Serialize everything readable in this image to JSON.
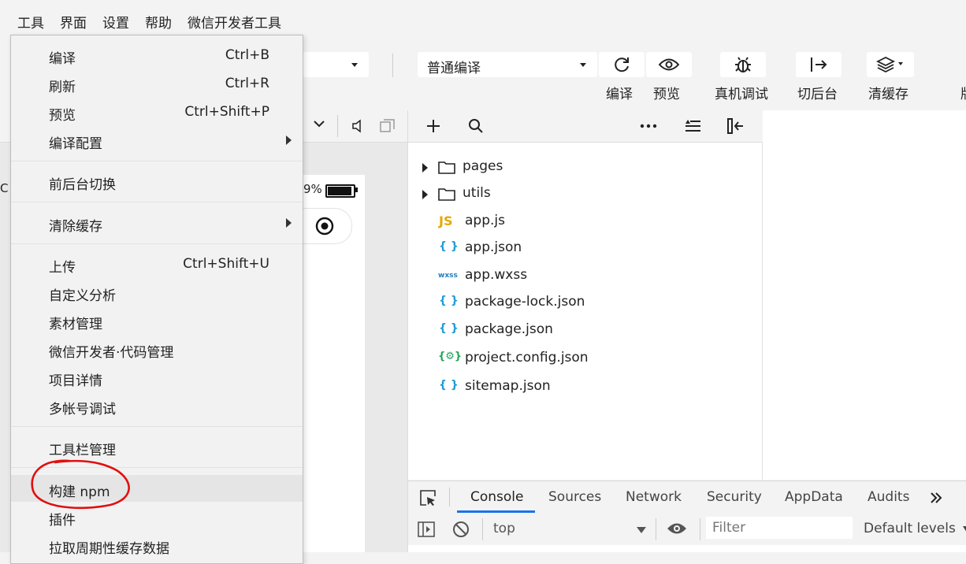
{
  "menubar": {
    "items": [
      "工具",
      "界面",
      "设置",
      "帮助",
      "微信开发者工具"
    ]
  },
  "toolbar": {
    "mode_select": "普通编译",
    "buttons": [
      {
        "label": "编译",
        "icon": "refresh-icon"
      },
      {
        "label": "预览",
        "icon": "eye-icon"
      },
      {
        "label": "真机调试",
        "icon": "bug-icon"
      },
      {
        "label": "切后台",
        "icon": "switch-background-icon"
      },
      {
        "label": "清缓存",
        "icon": "layers-icon"
      }
    ]
  },
  "simulator": {
    "battery_text": "9%"
  },
  "explorer": {
    "folders": [
      "pages",
      "utils"
    ],
    "files": [
      {
        "name": "app.js",
        "icon_text": "JS",
        "color": "#e6a700"
      },
      {
        "name": "app.json",
        "icon_text": "{ }",
        "color": "#1e9bd7"
      },
      {
        "name": "app.wxss",
        "icon_text": "wxss",
        "color": "#1e7fbf"
      },
      {
        "name": "package-lock.json",
        "icon_text": "{ }",
        "color": "#1e9bd7"
      },
      {
        "name": "package.json",
        "icon_text": "{ }",
        "color": "#1e9bd7"
      },
      {
        "name": "project.config.json",
        "icon_text": "{⚙}",
        "color": "#22a35a"
      },
      {
        "name": "sitemap.json",
        "icon_text": "{ }",
        "color": "#1e9bd7"
      }
    ]
  },
  "devtools": {
    "tabs": [
      "Console",
      "Sources",
      "Network",
      "Security",
      "AppData",
      "Audits"
    ],
    "active_tab": "Console",
    "context_select": "top",
    "filter_placeholder": "Filter",
    "levels": "Default levels"
  },
  "menu": {
    "items": [
      {
        "label": "编译",
        "shortcut": "Ctrl+B"
      },
      {
        "label": "刷新",
        "shortcut": "Ctrl+R"
      },
      {
        "label": "预览",
        "shortcut": "Ctrl+Shift+P"
      },
      {
        "label": "编译配置",
        "shortcut": ""
      },
      {
        "label": "前后台切换",
        "shortcut": ""
      },
      {
        "label": "清除缓存",
        "shortcut": ""
      },
      {
        "label": "上传",
        "shortcut": "Ctrl+Shift+U"
      },
      {
        "label": "自定义分析",
        "shortcut": ""
      },
      {
        "label": "素材管理",
        "shortcut": ""
      },
      {
        "label": "微信开发者·代码管理",
        "shortcut": ""
      },
      {
        "label": "项目详情",
        "shortcut": ""
      },
      {
        "label": "多帐号调试",
        "shortcut": ""
      },
      {
        "label": "工具栏管理",
        "shortcut": ""
      },
      {
        "label": "构建 npm",
        "shortcut": ""
      },
      {
        "label": "插件",
        "shortcut": ""
      },
      {
        "label": "拉取周期性缓存数据",
        "shortcut": ""
      }
    ]
  },
  "annotation_color": "#e01010"
}
